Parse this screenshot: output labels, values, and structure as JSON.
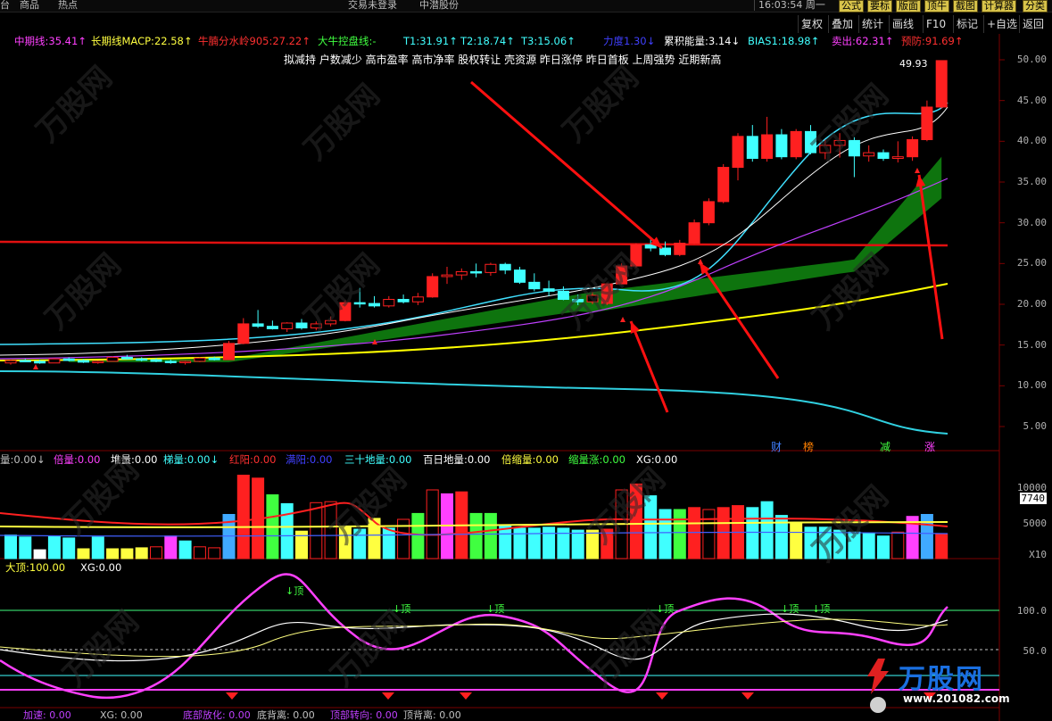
{
  "topbar": {
    "items": [
      "台",
      "商品",
      "热点"
    ],
    "center_left": "交易未登录",
    "center_right": "中潜股份",
    "clock": "16:03:54",
    "weekday": "周一",
    "tools": [
      "公式",
      "要标",
      "版面",
      "顶牛",
      "截图",
      "计算器",
      "分类"
    ]
  },
  "menu": [
    "复权",
    "叠加",
    "统计",
    "画线",
    "F10",
    "标记",
    "+自选",
    "返回"
  ],
  "indicators": [
    {
      "label": "中期线:",
      "value": "35.41↑",
      "color": "#ff40ff"
    },
    {
      "label": "长期线MACP:",
      "value": "22.58↑",
      "color": "#ffff40"
    },
    {
      "label": "牛腩分水岭905:",
      "value": "27.22↑",
      "color": "#ff3030"
    },
    {
      "label": "大牛控盘线:",
      "value": "-",
      "color": "#40ff40"
    },
    {
      "label": "T1:",
      "value": "31.91↑",
      "color": "#40ffff"
    },
    {
      "label": "T2:",
      "value": "18.74↑",
      "color": "#40ffff"
    },
    {
      "label": "T3:",
      "value": "15.06↑",
      "color": "#40ffff"
    },
    {
      "label": "力度",
      "value": "1.30↓",
      "color": "#4040ff"
    },
    {
      "label": "累积能量:",
      "value": "3.14↓",
      "color": "#ffffff"
    },
    {
      "label": "BIAS1:",
      "value": "18.98↑",
      "color": "#40ffff"
    },
    {
      "label": "卖出:",
      "value": "62.31↑",
      "color": "#ff40ff"
    },
    {
      "label": "预防:",
      "value": "91.69↑",
      "color": "#ff3030"
    }
  ],
  "signals_text": "拟减持 户数减少 高市盈率 高市净率 股权转让 壳资源 昨日涨停 昨日首板 上周强势 近期新高",
  "price_label": "49.93",
  "chart_markers": [
    "财",
    "榜",
    "减",
    "涨"
  ],
  "volume_bar": [
    {
      "label": "量:",
      "value": "0.00↓",
      "color": "#c0c0c0"
    },
    {
      "label": "倍量:",
      "value": "0.00",
      "color": "#ff40ff"
    },
    {
      "label": "堆量:",
      "value": "0.00",
      "color": "#ffffff"
    },
    {
      "label": "梯量:",
      "value": "0.00↓",
      "color": "#40ffff"
    },
    {
      "label": "红阳:",
      "value": "0.00",
      "color": "#ff3030"
    },
    {
      "label": "满阳:",
      "value": "0.00",
      "color": "#4040ff"
    },
    {
      "label": "三十地量:",
      "value": "0.00",
      "color": "#40ffff"
    },
    {
      "label": "百日地量:",
      "value": "0.00",
      "color": "#ffffff"
    },
    {
      "label": "倍缩量:",
      "value": "0.00",
      "color": "#ffff40"
    },
    {
      "label": "缩量涨:",
      "value": "0.00",
      "color": "#40ff40"
    },
    {
      "label": "XG:",
      "value": "0.00",
      "color": "#ffffff"
    }
  ],
  "volume_axis": [
    "10000",
    "7740",
    "5000",
    "X10"
  ],
  "osc_bar": [
    {
      "label": "大顶:",
      "value": "100.00",
      "color": "#ffff40"
    },
    {
      "label": "XG:",
      "value": "0.00",
      "color": "#ffffff"
    }
  ],
  "osc_axis": [
    "100.0",
    "50.0"
  ],
  "osc_top_label": "顶",
  "bottom_bar": [
    "加速: 0.00",
    "XG: 0.00",
    "底部放化: 0.00",
    "底背离: 0.00",
    "顶部转向: 0.00",
    "顶背离: 0.00"
  ],
  "price_axis": [
    "50.00",
    "45.00",
    "40.00",
    "35.00",
    "30.00",
    "25.00",
    "20.00",
    "15.00",
    "10.00",
    "5.00"
  ],
  "watermark": "万股网 www.201082.com",
  "logo": {
    "name": "万股网",
    "url": "www.201082.com"
  },
  "colors": {
    "up": "#ff2020",
    "down": "#40ffff",
    "band": "#0f7a0f",
    "red_line": "#e01010",
    "yellow_line": "#ffff00",
    "cyan_line": "#30d0e0",
    "magenta_line": "#c040ff"
  },
  "candles": [
    [
      12.8,
      13.2,
      12.6,
      13.1
    ],
    [
      13.1,
      13.3,
      12.9,
      13.0
    ],
    [
      13.0,
      13.2,
      12.7,
      12.8
    ],
    [
      12.8,
      13.4,
      12.8,
      13.3
    ],
    [
      13.3,
      13.5,
      13.0,
      13.1
    ],
    [
      13.1,
      13.3,
      12.8,
      12.9
    ],
    [
      12.9,
      13.1,
      12.7,
      13.0
    ],
    [
      13.0,
      13.6,
      13.0,
      13.5
    ],
    [
      13.5,
      13.8,
      13.2,
      13.3
    ],
    [
      13.3,
      13.5,
      13.0,
      13.2
    ],
    [
      13.2,
      13.4,
      12.9,
      13.0
    ],
    [
      13.0,
      13.2,
      12.7,
      12.9
    ],
    [
      12.9,
      13.1,
      12.6,
      13.0
    ],
    [
      13.0,
      13.5,
      12.9,
      13.4
    ],
    [
      13.4,
      13.6,
      13.1,
      13.2
    ],
    [
      13.2,
      15.5,
      13.2,
      15.2
    ],
    [
      15.2,
      18.3,
      15.1,
      17.6
    ],
    [
      17.6,
      19.3,
      17.1,
      17.3
    ],
    [
      17.3,
      18.0,
      16.9,
      17.0
    ],
    [
      17.0,
      17.8,
      16.6,
      17.7
    ],
    [
      17.7,
      18.2,
      16.9,
      17.1
    ],
    [
      17.1,
      17.9,
      16.8,
      17.6
    ],
    [
      17.6,
      18.5,
      17.3,
      18.0
    ],
    [
      18.0,
      20.5,
      17.9,
      20.2
    ],
    [
      20.2,
      22.0,
      19.6,
      20.1
    ],
    [
      20.1,
      21.0,
      19.6,
      19.8
    ],
    [
      19.8,
      21.0,
      19.6,
      20.6
    ],
    [
      20.6,
      21.2,
      20.1,
      20.3
    ],
    [
      20.3,
      21.4,
      19.9,
      20.9
    ],
    [
      20.9,
      23.8,
      20.8,
      23.4
    ],
    [
      23.4,
      24.6,
      22.5,
      23.6
    ],
    [
      23.6,
      24.4,
      23.0,
      24.0
    ],
    [
      24.0,
      25.0,
      23.3,
      23.9
    ],
    [
      23.9,
      25.1,
      23.5,
      24.9
    ],
    [
      24.9,
      25.1,
      23.7,
      24.2
    ],
    [
      24.2,
      24.6,
      22.5,
      22.7
    ],
    [
      22.7,
      23.8,
      21.6,
      21.9
    ],
    [
      21.9,
      22.9,
      21.0,
      21.6
    ],
    [
      21.6,
      22.2,
      20.5,
      20.6
    ],
    [
      20.6,
      21.2,
      19.9,
      20.3
    ],
    [
      20.3,
      21.5,
      20.0,
      21.1
    ],
    [
      20.1,
      22.6,
      19.9,
      22.5
    ],
    [
      22.5,
      25.0,
      22.4,
      24.7
    ],
    [
      24.7,
      27.5,
      24.5,
      27.3
    ],
    [
      27.3,
      28.0,
      26.5,
      26.9
    ],
    [
      26.9,
      27.7,
      25.9,
      26.1
    ],
    [
      26.1,
      27.9,
      25.9,
      27.5
    ],
    [
      27.5,
      30.4,
      27.4,
      30.0
    ],
    [
      30.0,
      33.0,
      29.7,
      32.6
    ],
    [
      32.6,
      37.2,
      32.4,
      36.8
    ],
    [
      36.8,
      41.0,
      35.2,
      40.6
    ],
    [
      40.6,
      42.0,
      37.5,
      37.9
    ],
    [
      37.9,
      43.0,
      37.5,
      40.8
    ],
    [
      40.8,
      41.5,
      37.8,
      38.1
    ],
    [
      38.1,
      41.5,
      37.8,
      41.2
    ],
    [
      41.2,
      42.0,
      38.4,
      38.6
    ],
    [
      38.6,
      40.2,
      37.8,
      39.5
    ],
    [
      39.5,
      41.0,
      38.0,
      40.1
    ],
    [
      40.1,
      40.5,
      35.6,
      38.2
    ],
    [
      38.2,
      39.5,
      37.5,
      38.6
    ],
    [
      38.6,
      39.0,
      37.6,
      37.9
    ],
    [
      37.9,
      40.0,
      37.4,
      38.1
    ],
    [
      38.1,
      40.6,
      37.6,
      40.2
    ],
    [
      40.2,
      45.0,
      40.0,
      44.2
    ],
    [
      44.2,
      49.9,
      44.0,
      49.9
    ]
  ]
}
